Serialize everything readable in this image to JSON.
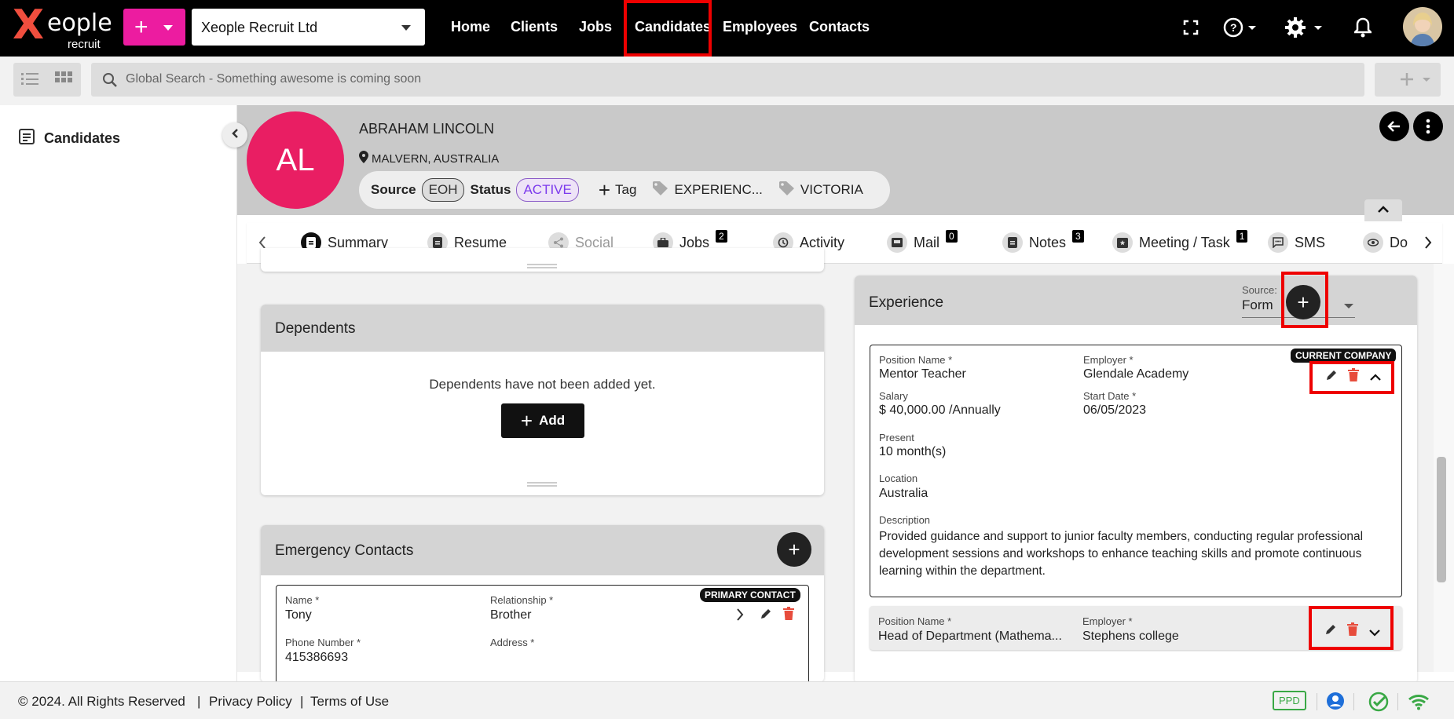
{
  "brand": {
    "logo_word": "eople",
    "logo_sub": "recruit"
  },
  "topbar": {
    "quick_add_label": "+",
    "company": "Xeople Recruit Ltd",
    "nav": [
      "Home",
      "Clients",
      "Jobs",
      "Candidates",
      "Employees",
      "Contacts"
    ]
  },
  "search": {
    "placeholder": "Global Search - Something awesome is coming soon"
  },
  "sidebar": {
    "items": [
      {
        "label": "Candidates"
      }
    ]
  },
  "candidate": {
    "initials": "AL",
    "name": "ABRAHAM LINCOLN",
    "location": "MALVERN, AUSTRALIA",
    "source_label": "Source",
    "source_value": "EOH",
    "status_label": "Status",
    "status_value": "ACTIVE",
    "tag_button": "Tag",
    "tags": [
      "EXPERIENC...",
      "VICTORIA"
    ]
  },
  "tabs": [
    {
      "label": "Summary",
      "badge": ""
    },
    {
      "label": "Resume",
      "badge": ""
    },
    {
      "label": "Social",
      "badge": ""
    },
    {
      "label": "Jobs",
      "badge": "2"
    },
    {
      "label": "Activity",
      "badge": ""
    },
    {
      "label": "Mail",
      "badge": "0"
    },
    {
      "label": "Notes",
      "badge": "3"
    },
    {
      "label": "Meeting / Task",
      "badge": "1"
    },
    {
      "label": "SMS",
      "badge": ""
    },
    {
      "label": "Do",
      "badge": ""
    }
  ],
  "dependents": {
    "title": "Dependents",
    "empty_text": "Dependents have not been added yet.",
    "add_label": "Add"
  },
  "emergency": {
    "title": "Emergency Contacts",
    "badge": "PRIMARY CONTACT",
    "name_label": "Name *",
    "name": "Tony",
    "relationship_label": "Relationship *",
    "relationship": "Brother",
    "phone_label": "Phone Number *",
    "phone": "415386693",
    "address_label": "Address *"
  },
  "experience": {
    "title": "Experience",
    "source_label": "Source:",
    "source_value": "Form",
    "items": [
      {
        "badge": "CURRENT COMPANY",
        "position_label": "Position Name *",
        "position": "Mentor Teacher",
        "employer_label": "Employer *",
        "employer": "Glendale Academy",
        "salary_label": "Salary",
        "salary": "$ 40,000.00 /Annually",
        "start_label": "Start Date *",
        "start": "06/05/2023",
        "present_label": "Present",
        "present": "10 month(s)",
        "location_label": "Location",
        "location": "Australia",
        "description_label": "Description",
        "description": "Provided guidance and support to junior faculty members, conducting regular professional development sessions and workshops to enhance teaching skills and promote continuous learning within the department."
      },
      {
        "position_label": "Position Name *",
        "position": "Head of Department (Mathema...",
        "employer_label": "Employer *",
        "employer": "Stephens college"
      }
    ]
  },
  "footer": {
    "copyright": "© 2024. All Rights Reserved",
    "privacy": "Privacy Policy",
    "terms": "Terms of Use",
    "ppd": "PPD",
    "sep": "|"
  },
  "colors": {
    "brand_pink": "#ec1ca0",
    "avatar_red": "#e91e63",
    "highlight_red": "#e00000",
    "status_purple": "#7c3aed"
  },
  "icons": [
    "fullscreen-icon",
    "help-icon",
    "gear-icon",
    "bell-icon",
    "search-icon",
    "list-view-icon",
    "grid-view-icon",
    "location-pin-icon",
    "tag-icon",
    "pencil-icon",
    "trash-icon",
    "chevron-up-icon",
    "chevron-down-icon",
    "chevron-right-icon",
    "wifi-icon",
    "check-icon",
    "user-icon"
  ]
}
